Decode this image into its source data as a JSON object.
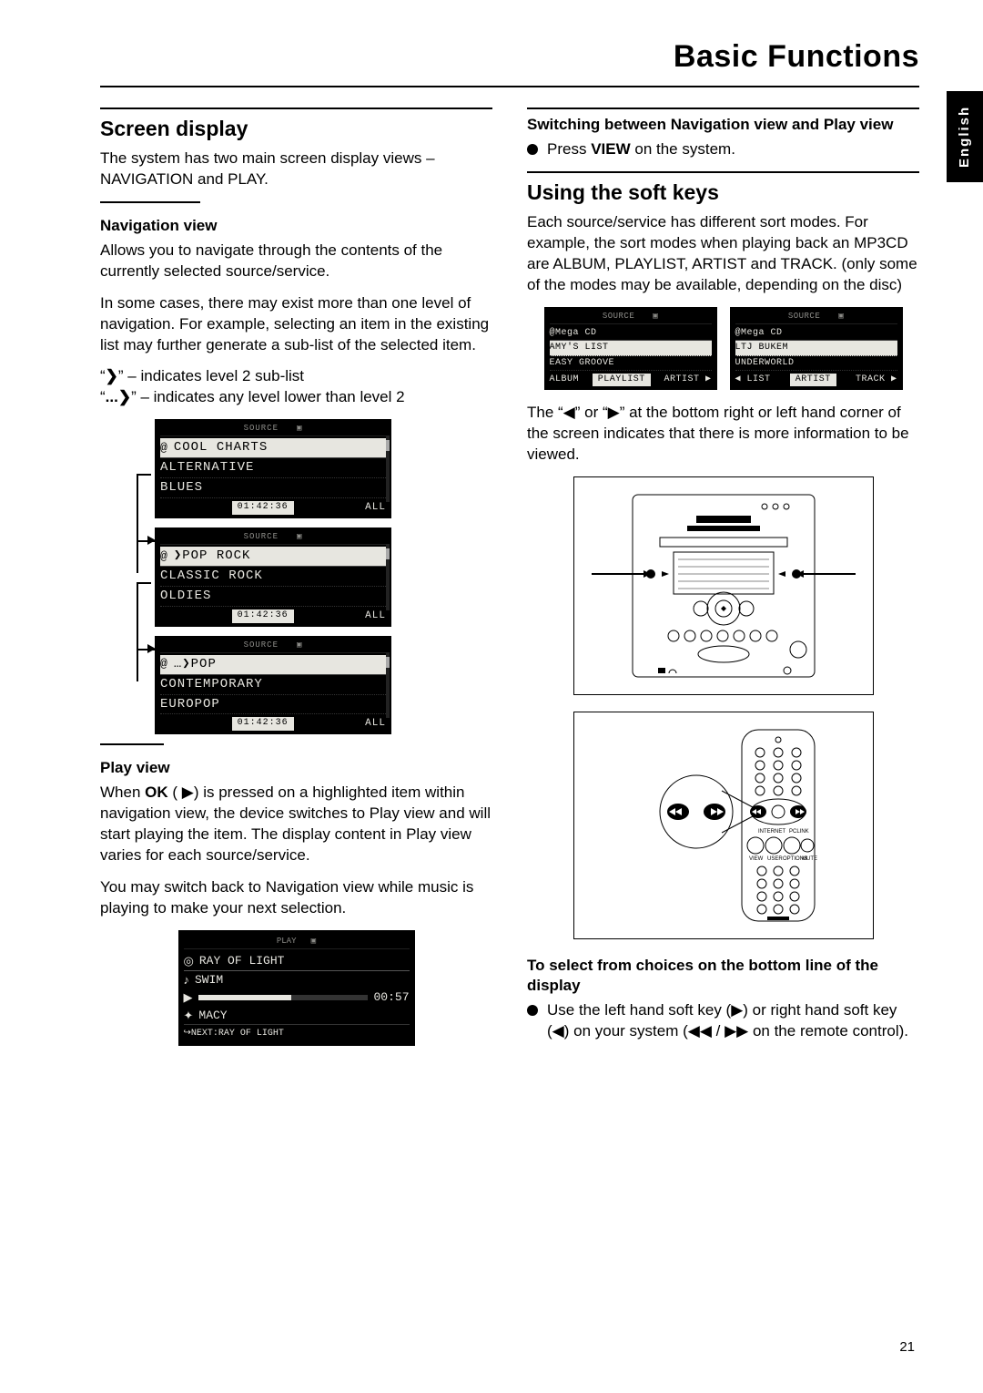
{
  "page": {
    "chapter": "Basic Functions",
    "number": "21",
    "lang_tab": "English"
  },
  "left": {
    "h2": "Screen display",
    "intro": "The system has two main screen display views – NAVIGATION and PLAY.",
    "nav_heading": "Navigation view",
    "nav_p1": "Allows you to navigate through the contents of the currently selected source/service.",
    "nav_p2": "In some cases, there may exist more than one level of navigation. For example, selecting an item in the existing list may further generate a sub-list of the selected item.",
    "ind1_pre": "“",
    "ind1_sym": "❯",
    "ind1_post": "” – indicates level 2 sub-list",
    "ind2_pre": "“",
    "ind2_sym": "...❯",
    "ind2_post": "” – indicates any level lower than level 2",
    "lcd1": {
      "header": "COOL CHARTS",
      "row1": "ALTERNATIVE",
      "row2": "BLUES",
      "foot_mid": "01:42:36",
      "foot_right": "ALL"
    },
    "lcd2": {
      "header": "❯POP ROCK",
      "row1": "CLASSIC ROCK",
      "row2": "OLDIES",
      "foot_mid": "01:42:36",
      "foot_right": "ALL"
    },
    "lcd3": {
      "header": "…❯POP",
      "row1": "CONTEMPORARY",
      "row2": "EUROPOP",
      "foot_mid": "01:42:36",
      "foot_right": "ALL"
    },
    "play_heading": "Play view",
    "play_p1a": "When ",
    "play_p1_ok": "OK",
    "play_p1b": " ( ▶) is pressed on a highlighted item within navigation view, the device switches to Play view and will start playing the item.  The display content in Play view varies for each source/service.",
    "play_p2": "You may switch back to Navigation view while music is playing to make your next selection.",
    "play_lcd": {
      "title": "RAY OF LIGHT",
      "track": "SWIM",
      "time": "00:57",
      "artist": "MACY",
      "next": "NEXT:RAY OF LIGHT"
    }
  },
  "right": {
    "switch_heading": "Switching between Navigation view and Play view",
    "switch_b_pre": "Press ",
    "switch_b_bold": "VIEW",
    "switch_b_post": " on the system.",
    "soft_h2": "Using the soft keys",
    "soft_p1": "Each source/service has different sort modes. For example, the sort modes when playing back an MP3CD are ALBUM, PLAYLIST, ARTIST and TRACK. (only some of the modes may be available, depending on the disc)",
    "lcdA": {
      "header": "@Mega CD",
      "row1": "AMY'S LIST",
      "row2": "EASY GROOVE",
      "foot_l": "ALBUM",
      "foot_m": "PLAYLIST",
      "foot_r": "ARTIST ▶"
    },
    "lcdB": {
      "header": "@Mega CD",
      "row1": "LTJ BUKEM",
      "row2": "UNDERWORLD",
      "foot_l": "◀ LIST",
      "foot_m": "ARTIST",
      "foot_r": "TRACK ▶"
    },
    "soft_p2": "The “◀” or “▶” at the bottom right or left hand corner of the screen indicates that there is more information to be viewed.",
    "select_heading": "To select from choices on the bottom line of the display",
    "select_b": "Use the left hand soft key (▶) or right hand soft key (◀) on your system (◀◀ / ▶▶ on the remote control)."
  }
}
